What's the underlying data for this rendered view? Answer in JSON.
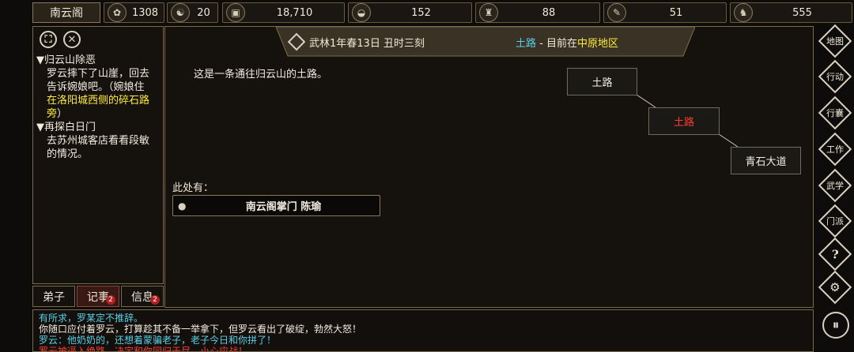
{
  "top_bar": {
    "sect_name": "南云阁",
    "stats": [
      {
        "icon": "coin-bag-icon",
        "value": "1308"
      },
      {
        "icon": "taiji-icon",
        "value": "20"
      },
      {
        "icon": "copper-coin-icon",
        "value": "18,710"
      },
      {
        "icon": "food-bowl-icon",
        "value": "152"
      },
      {
        "icon": "bottle-icon",
        "value": "88"
      },
      {
        "icon": "scroll-icon",
        "value": "51"
      },
      {
        "icon": "beast-icon",
        "value": "555"
      }
    ]
  },
  "quest_panel": {
    "quests": [
      {
        "title": "▼归云山除恶",
        "line1": "罗云摔下了山崖，回去",
        "line2": "告诉婉娘吧。（婉娘住",
        "line3_highlight": "在洛阳城西侧的碎石路",
        "line4_highlight": "旁",
        "line4_tail": "）"
      },
      {
        "title": "▼再探白日门",
        "line1": "去苏州城客店看看段敏",
        "line2": "的情况。"
      }
    ],
    "tabs": [
      {
        "label": "弟子",
        "badge": ""
      },
      {
        "label": "记事",
        "badge": "2"
      },
      {
        "label": "信息",
        "badge": "2"
      }
    ]
  },
  "header": {
    "date": "武林1年春13日 丑时三刻",
    "location": "土路",
    "separator": " - 目前在",
    "region": "中原地区"
  },
  "main": {
    "description": "这是一条通往归云山的土路。",
    "present_label": "此处有：",
    "npcs": [
      {
        "name": "南云阁掌门 陈瑜"
      }
    ]
  },
  "map": {
    "nodes": [
      {
        "label": "土路",
        "current": false
      },
      {
        "label": "土路",
        "current": true
      },
      {
        "label": "青石大道",
        "current": false
      }
    ]
  },
  "side_menu": [
    {
      "label": "地图"
    },
    {
      "label": "行动"
    },
    {
      "label": "行囊"
    },
    {
      "label": "工作"
    },
    {
      "label": "武学"
    },
    {
      "label": "门派"
    },
    {
      "label": "?"
    },
    {
      "label": "⚙"
    },
    {
      "label": "⏸"
    }
  ],
  "log": [
    {
      "text": "有所求，罗某定不推辞。",
      "color": "#5ad0e6"
    },
    {
      "text": "你随口应付着罗云，打算趁其不备一举拿下，但罗云看出了破绽，勃然大怒！",
      "color": "#f2ece0"
    },
    {
      "text": "罗云：他奶奶的，还想着蒙骗老子，老子今日和你拼了！",
      "color": "#5ad0e6"
    },
    {
      "text": "罗云被逼入绝路，决定和你同归于尽，小心应战！",
      "color": "#ff3b30"
    }
  ],
  "colors": {
    "accent_gold": "#8c7650",
    "highlight_yellow": "#ffeb3b",
    "cyan_text": "#5ad0e6",
    "alert_red": "#ff3b30"
  }
}
